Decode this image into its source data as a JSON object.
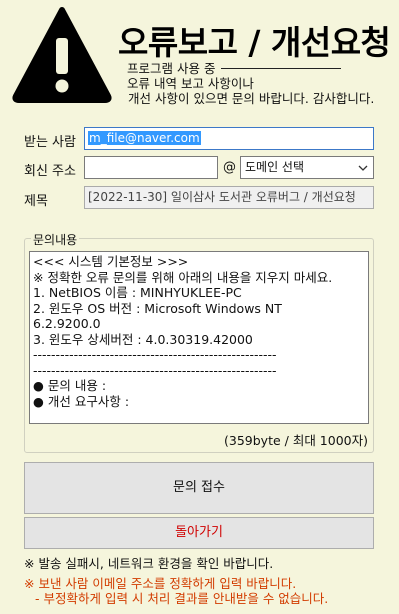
{
  "header": {
    "title": "오류보고 / 개선요청",
    "subtitle_lines": [
      "프로그램 사용 중",
      "오류 내역 보고 사항이나",
      "개선 사항이 있으면 문의 바랍니다. 감사합니다."
    ]
  },
  "form": {
    "sender_label": "받는 사람",
    "sender_value": "m_file@naver.com",
    "reply_label": "회신 주소",
    "reply_value": "",
    "at_sign": "@",
    "domain_select": "도메인 선택",
    "subject_label": "제목",
    "subject_value": "[2022-11-30] 일이삼사 도서관 오류버그 / 개선요청"
  },
  "inquiry": {
    "legend": "문의내용",
    "lines": [
      "<<< 시스템 기본정보 >>>",
      "※ 정확한 오류 문의를 위해 아래의 내용을 지우지 마세요.",
      "1. NetBIOS 이름 : MINHYUKLEE-PC",
      "2. 윈도우 OS 버전 : Microsoft Windows NT",
      "6.2.9200.0",
      "3. 윈도우 상세버전 : 4.0.30319.42000",
      "------------------------------------------------------",
      "------------------------------------------------------",
      "● 문의 내용 :",
      "● 개선 요구사항 :"
    ],
    "counter": "(359byte / 최대 1000자)"
  },
  "buttons": {
    "submit": "문의 접수",
    "back": "돌아가기"
  },
  "notes": {
    "network": "※ 발송 실패시, 네트워크 환경을 확인 바랍니다.",
    "email_warning": "※ 보낸 사람 이메일 주소를 정확하게 입력 바랍니다.",
    "email_warning_sub": "- 부정확하게 입력 시 처리 결과를 안내받을 수 없습니다."
  },
  "colors": {
    "background": "#f5f5dc",
    "warning_text": "#d23c00",
    "back_button_text": "#d00000",
    "selection": "#3399ff"
  },
  "icons": {
    "warning": "warning-triangle-icon",
    "dropdown": "chevron-down-icon"
  }
}
